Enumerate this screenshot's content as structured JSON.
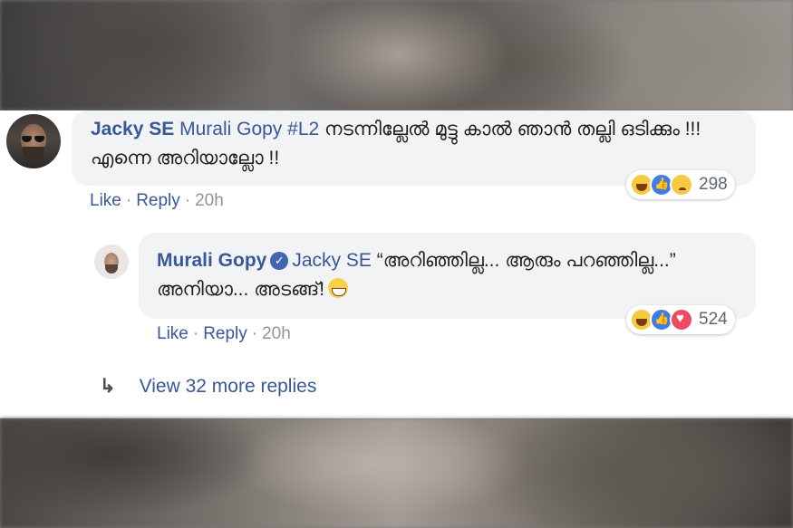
{
  "comment1": {
    "author": "Jacky SE",
    "mention": "Murali Gopy",
    "tag": "#L2",
    "text": " നടന്നില്ലേൽ മുട്ടു കാൽ ഞാൻ തല്ലി ഒടിക്കും !!! എന്നെ അറിയാല്ലോ !!",
    "like_label": "Like",
    "reply_label": "Reply",
    "time": "20h",
    "reaction_count": "298",
    "reactions": [
      "haha-icon",
      "like-icon",
      "sad-icon"
    ]
  },
  "comment2": {
    "author": "Murali Gopy",
    "verified_icon": "verified-badge-icon",
    "mention": "Jacky SE",
    "text": " “അറിഞ്ഞില്ല... ആരും പറഞ്ഞില്ല...” അനിയാ... അടങ്ങ്!",
    "like_label": "Like",
    "reply_label": "Reply",
    "time": "20h",
    "reaction_count": "524",
    "reactions": [
      "haha-icon",
      "like-icon",
      "love-icon"
    ]
  },
  "more_replies": {
    "label": "View 32 more replies"
  },
  "colors": {
    "link": "#385898",
    "bubble": "#f2f3f5",
    "verified": "#4267b2"
  }
}
